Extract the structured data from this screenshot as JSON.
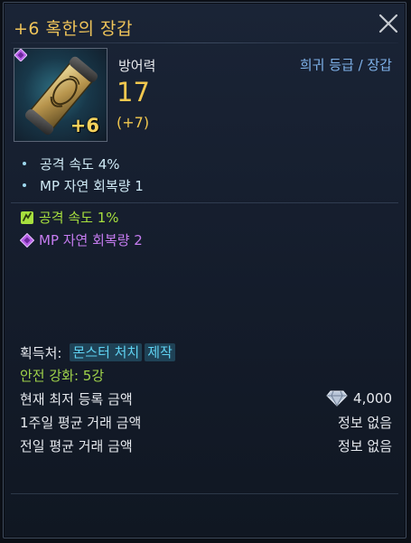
{
  "item": {
    "title": "+6 혹한의 장갑",
    "grade_type": "희귀 등급 / 장갑",
    "enhance_label": "+6",
    "icon": "bracer-item-icon",
    "grade_gem_icon": "purple-diamond-icon"
  },
  "main_stat": {
    "label": "방어력",
    "value": "17",
    "bonus": "(+7)"
  },
  "basic_options": [
    {
      "text": "공격 속도 4%"
    },
    {
      "text": "MP 자연 회복량 1"
    }
  ],
  "extra_options": [
    {
      "text": "공격 속도 1%",
      "icon": "green-rune-icon",
      "color": "#a7df3e"
    },
    {
      "text": "MP 자연 회복량 2",
      "icon": "purple-diamond-icon",
      "color": "#c57cf0"
    }
  ],
  "acquisition": {
    "label": "획득처:",
    "sources": [
      "몬스터 처치",
      "제작"
    ]
  },
  "safe_enhance": "안전 강화: 5강",
  "market": [
    {
      "label": "현재 최저 등록 금액",
      "value": "4,000",
      "icon": "crystal-diamond-icon"
    },
    {
      "label": "1주일 평균 거래 금액",
      "value": "정보 없음"
    },
    {
      "label": "전일 평균 거래 금액",
      "value": "정보 없음"
    }
  ],
  "colors": {
    "title": "#efc45a",
    "stat": "#f2c84f",
    "grade_type": "#7fb2ea",
    "source_tag": "#5fd2f2",
    "safe_enhance": "#9fd24a"
  }
}
